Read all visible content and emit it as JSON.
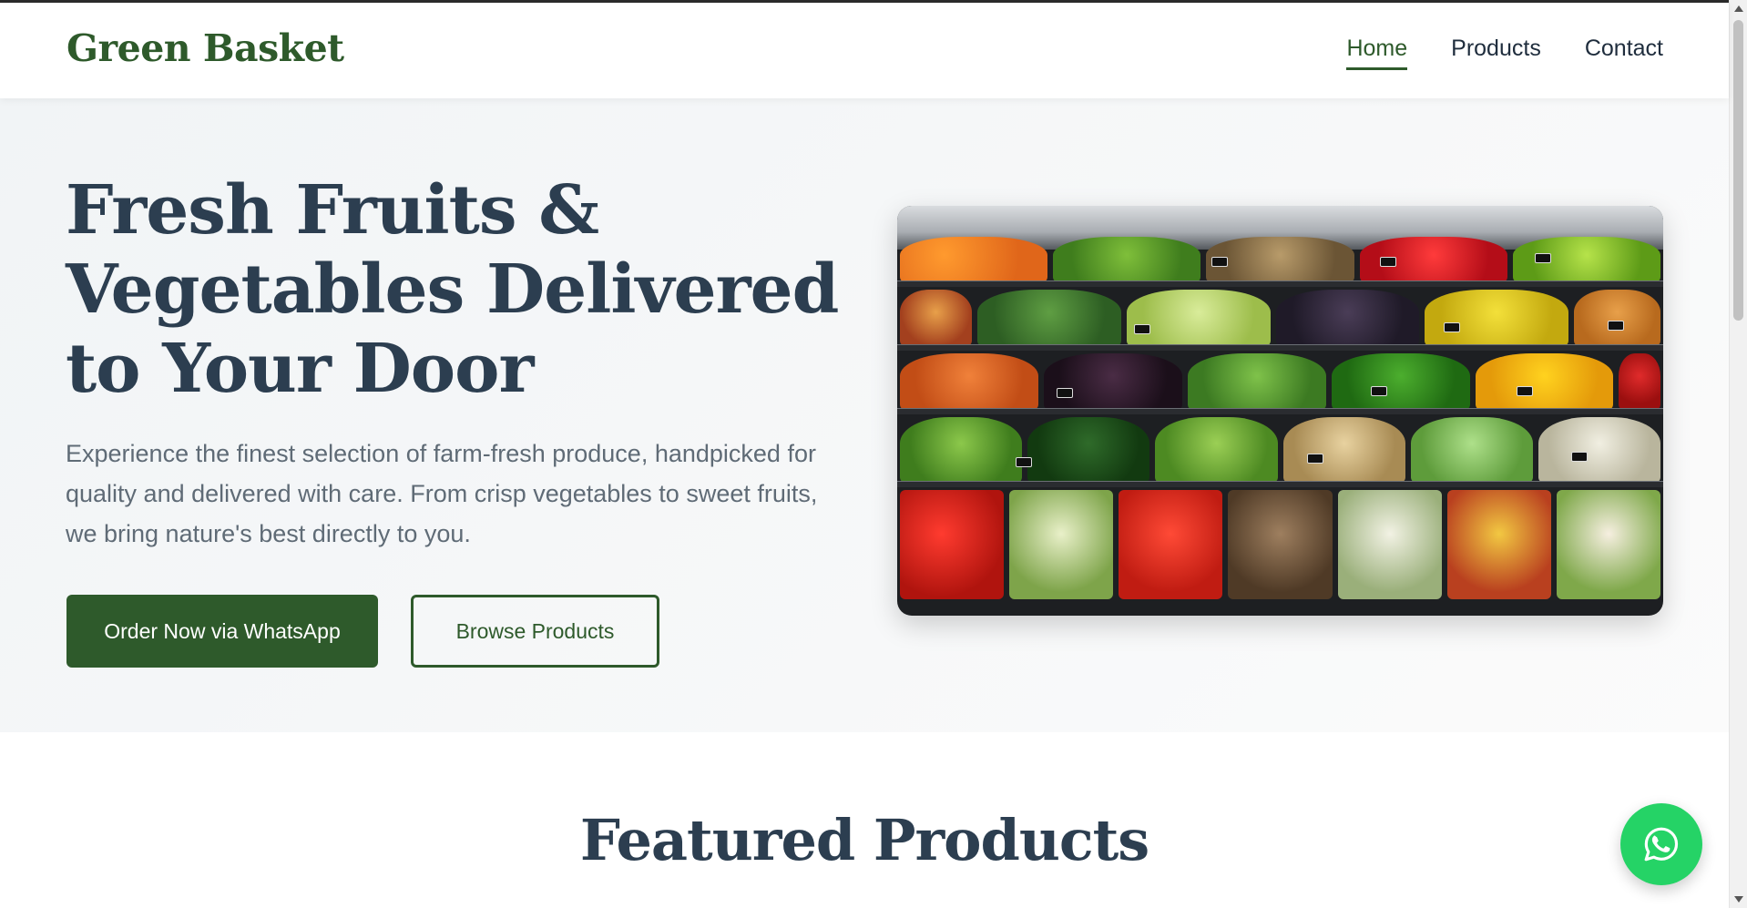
{
  "header": {
    "logo": "Green Basket",
    "nav": [
      {
        "label": "Home",
        "active": true
      },
      {
        "label": "Products",
        "active": false
      },
      {
        "label": "Contact",
        "active": false
      }
    ]
  },
  "hero": {
    "title": "Fresh Fruits & Vegetables Delivered to Your Door",
    "description": "Experience the finest selection of farm-fresh produce, handpicked for quality and delivered with care. From crisp vegetables to sweet fruits, we bring nature's best directly to you.",
    "primary_button": "Order Now via WhatsApp",
    "secondary_button": "Browse Products",
    "image_subject": "produce-shelves"
  },
  "featured": {
    "title": "Featured Products"
  },
  "floating_button": {
    "icon": "whatsapp-icon",
    "color": "#25d366"
  },
  "colors": {
    "brand": "#2e5a2b",
    "heading": "#2c3e50",
    "body_text": "#5f6b76"
  }
}
